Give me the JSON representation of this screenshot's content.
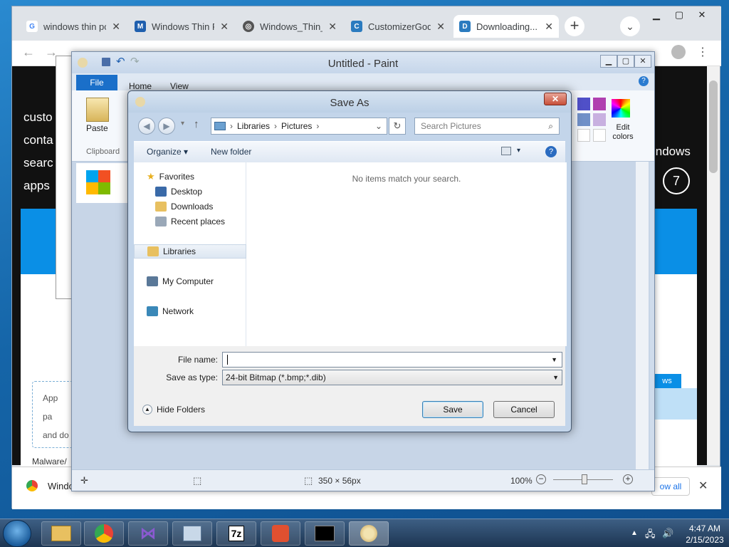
{
  "browser": {
    "tabs": [
      {
        "label": "windows thin pc",
        "icon": "google-icon"
      },
      {
        "label": "Windows Thin PC",
        "icon": "m-site-icon"
      },
      {
        "label": "Windows_Thin_PC",
        "icon": "globe-icon"
      },
      {
        "label": "CustomizerGod",
        "icon": "customizergod-icon"
      },
      {
        "label": "Downloading...",
        "icon": "download-site-icon"
      }
    ],
    "page": {
      "sidebar_links": [
        "custo",
        "conta",
        "searc",
        "apps"
      ],
      "aside_text": "indows",
      "badge_number": "7",
      "card_lines": [
        "App",
        "pa",
        "and do"
      ],
      "footer_text": "Malware/",
      "view_button": "ws"
    },
    "download_bar": {
      "item": "Windo",
      "show_all": "ow all"
    }
  },
  "paint": {
    "title": "Untitled - Paint",
    "tabs": {
      "file": "File",
      "home": "Home",
      "view": "View"
    },
    "paste_label": "Paste",
    "clipboard_label": "Clipboard",
    "edit_colors_label": "Edit colors",
    "status": {
      "size": "350 × 56px",
      "zoom": "100%"
    }
  },
  "dialog": {
    "title": "Save As",
    "address": {
      "crumbs": [
        "Libraries",
        "Pictures"
      ]
    },
    "search_placeholder": "Search Pictures",
    "commands": {
      "organize": "Organize",
      "new_folder": "New folder"
    },
    "nav": {
      "favorites": "Favorites",
      "desktop": "Desktop",
      "downloads": "Downloads",
      "recent": "Recent places",
      "libraries": "Libraries",
      "computer": "My Computer",
      "network": "Network"
    },
    "empty_message": "No items match your search.",
    "file_name_label": "File name:",
    "file_name_value": "",
    "save_type_label": "Save as type:",
    "save_type_value": "24-bit Bitmap (*.bmp;*.dib)",
    "hide_folders": "Hide Folders",
    "save_button": "Save",
    "cancel_button": "Cancel"
  },
  "taskbar": {
    "time": "4:47 AM",
    "date": "2/15/2023",
    "apps": [
      "explorer-icon",
      "chrome-icon",
      "visual-studio-icon",
      "control-panel-icon",
      "7zip-icon",
      "customizergod-icon",
      "cmd-icon",
      "paint-icon"
    ]
  }
}
